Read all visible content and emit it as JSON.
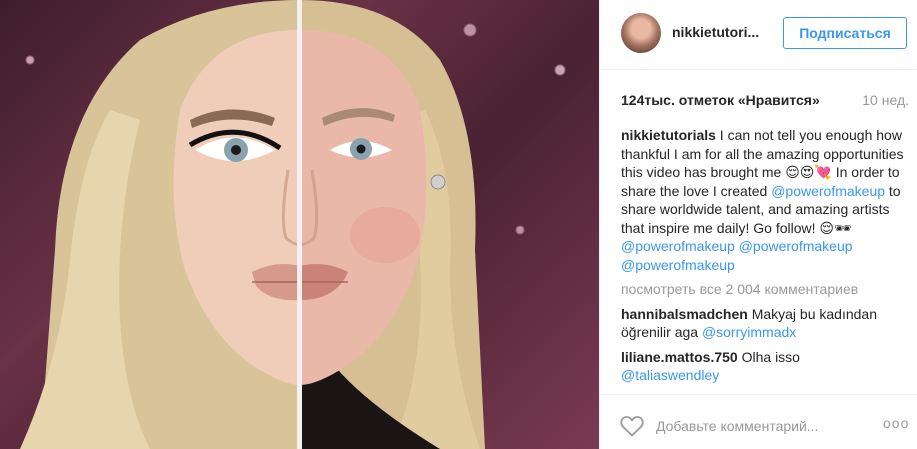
{
  "post": {
    "username": "nikkietutori...",
    "follow_label": "Подписаться",
    "likes": "124тыс. отметок «Нравится»",
    "time": "10 нед."
  },
  "caption": {
    "user": "nikkietutorials",
    "text_1": " I can not tell you enough how thankful I am for all the amazing opportunities this video has brought me 😌😍💘 In order to share the love I created ",
    "link_1": "@powerofmakeup",
    "text_2": " to share worldwide talent, and amazing artists that inspire me daily! Go follow! 😌🕶 ",
    "link_2": "@powerofmakeup",
    "link_3": "@powerofmakeup",
    "link_4": "@powerofmakeup"
  },
  "view_all": "посмотреть все 2 004 комментариев",
  "comments": [
    {
      "user": "hannibalsmadchen",
      "text": " Makyaj bu kadından öğrenilir aga ",
      "link": "@sorryimmadx"
    },
    {
      "user": "liliane.mattos.750",
      "text": " Olha isso",
      "link": "@taliaswendley"
    }
  ],
  "footer": {
    "placeholder": "Добавьте комментарий...",
    "more": "ooo",
    "heart_icon": "heart-outline-icon"
  },
  "colors": {
    "link": "#3897f0",
    "muted": "#999999",
    "text": "#262626",
    "border": "#efefef"
  }
}
